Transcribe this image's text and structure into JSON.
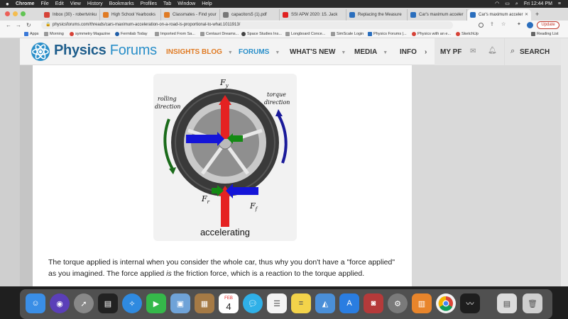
{
  "menubar": {
    "items": [
      "Chrome",
      "File",
      "Edit",
      "View",
      "History",
      "Bookmarks",
      "Profiles",
      "Tab",
      "Window",
      "Help"
    ],
    "clock": "Fri 12:44 PM"
  },
  "tabs": [
    {
      "label": "Inbox (30) - robertvinku",
      "fav_color": "#d64237"
    },
    {
      "label": "High School Yearbooks",
      "fav_color": "#e07b24"
    },
    {
      "label": "Classmates - Find your",
      "fav_color": "#e07b24"
    },
    {
      "label": "capacitors5 (1).pdf",
      "fav_color": "#777777"
    },
    {
      "label": "SSI APW 2020: 15. Jack",
      "fav_color": "#e02020"
    },
    {
      "label": "Replacing the Measure",
      "fav_color": "#2a6ebd"
    },
    {
      "label": "Car's maximum acceler",
      "fav_color": "#2a6ebd"
    },
    {
      "label": "Car's maximum acceler",
      "fav_color": "#2a6ebd"
    }
  ],
  "address": {
    "url": "physicsforums.com/threads/cars-maximum-acceleration-on-a-road-is-proportional-to-what.1011913/",
    "update_label": "Update"
  },
  "bookmarks": [
    "Apps",
    "Morning",
    "symmetry Magazine",
    "Fermilab Today",
    "Imported From Sa...",
    "Centauri Dreams...",
    "Space Studies Ins...",
    "Longboard Conce...",
    "SimScale Login",
    "Physics Forums |...",
    "Physics with an e...",
    "SketchUp"
  ],
  "reading_list": "Reading List",
  "site": {
    "logo_word1": "Physics",
    "logo_word2": "Forums",
    "nav": [
      "INSIGHTS BLOG",
      "FORUMS",
      "WHAT'S NEW",
      "MEDIA",
      "INFO"
    ],
    "my_pf": "MY PF",
    "search": "SEARCH"
  },
  "figure": {
    "label_fy": "F",
    "label_fy_sub": "y",
    "label_fr": "F",
    "label_fr_sub": "r",
    "label_ff": "F",
    "label_ff_sub": "f",
    "rolling_line1": "rolling",
    "rolling_line2": "direction",
    "torque_line1": "torque",
    "torque_line2": "direction",
    "caption": "accelerating"
  },
  "post": {
    "line1_part1": "The torque applied is internal when you consider the whole car, thus why you don't have a \"force applied\"",
    "line2_part1": "as you imagined. The force applied ",
    "line2_italic": "is",
    "line2_part2": " the friction force, which is a reaction to the torque applied."
  },
  "dock": [
    {
      "name": "finder",
      "color": "#3a8ee6"
    },
    {
      "name": "siri",
      "color": "#5b3fb8"
    },
    {
      "name": "launchpad",
      "color": "#888888"
    },
    {
      "name": "activity-monitor",
      "color": "#222222"
    },
    {
      "name": "safari",
      "color": "#2f8ae0"
    },
    {
      "name": "facetime",
      "color": "#35b84a"
    },
    {
      "name": "preview",
      "color": "#6fa3d8"
    },
    {
      "name": "notes-brown",
      "color": "#a57a45"
    },
    {
      "name": "calendar",
      "color": "#ffffff"
    },
    {
      "name": "messages",
      "color": "#2fb0e8"
    },
    {
      "name": "reminders",
      "color": "#f4f4f4"
    },
    {
      "name": "notes",
      "color": "#f3d34a"
    },
    {
      "name": "keynote",
      "color": "#4a8fd8"
    },
    {
      "name": "app-store",
      "color": "#2a7de1"
    },
    {
      "name": "photo-booth",
      "color": "#b53a3a"
    },
    {
      "name": "system-preferences",
      "color": "#7a7a7a"
    },
    {
      "name": "books",
      "color": "#e8852b"
    },
    {
      "name": "chrome",
      "color": "#f2f2f2"
    },
    {
      "name": "stocks",
      "color": "#1e1e1e"
    },
    {
      "name": "files",
      "color": "#dcdcdc"
    },
    {
      "name": "trash",
      "color": "#cfcfcf"
    }
  ],
  "calendar_day": "4",
  "calendar_month": "FEB"
}
